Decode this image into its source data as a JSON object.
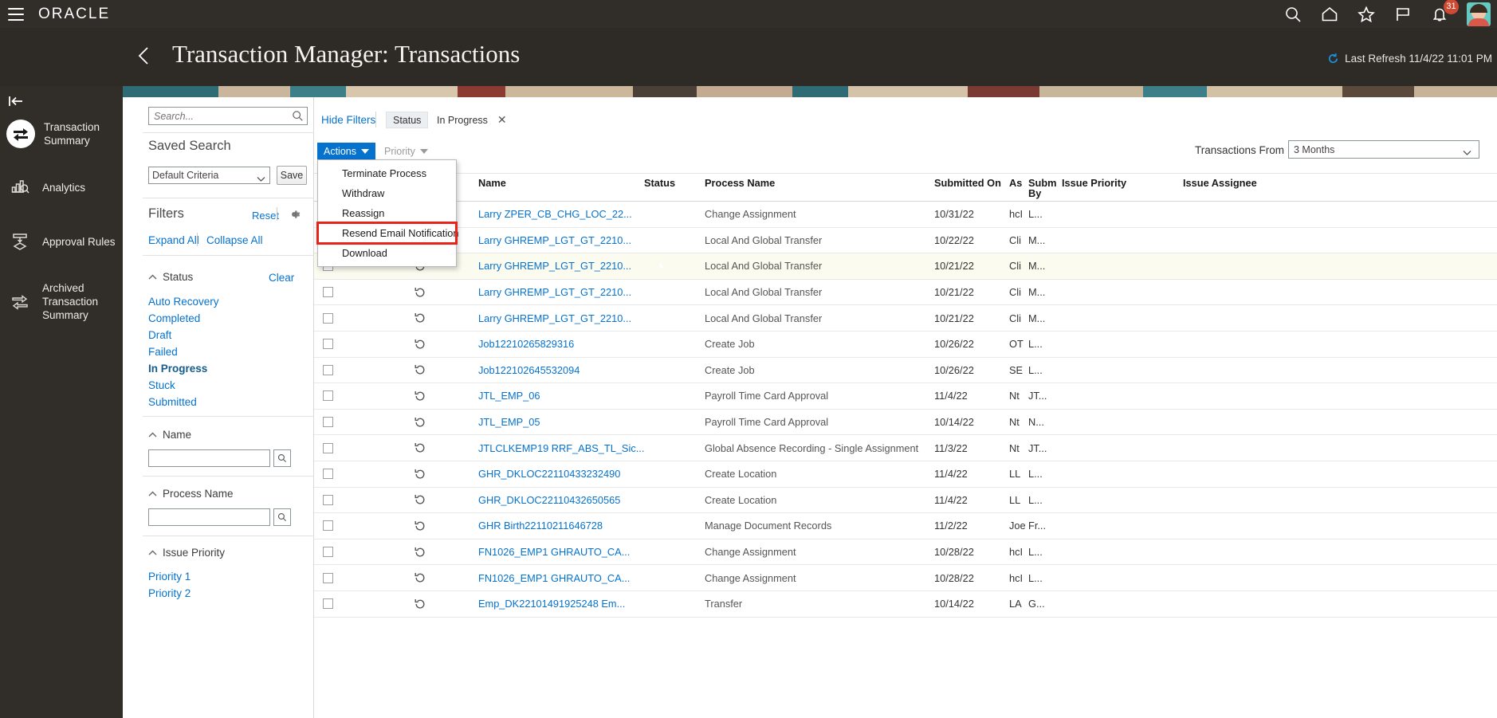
{
  "header": {
    "logo": "ORACLE",
    "menu_icon": "hamburger-icon",
    "icons": [
      "search-icon",
      "home-icon",
      "favorites-star-icon",
      "flag-icon",
      "notifications-bell-icon"
    ],
    "notification_count": "31"
  },
  "page": {
    "title": "Transaction Manager: Transactions",
    "last_refresh": "Last Refresh 11/4/22 11:01 PM",
    "back_label": "back-chevron"
  },
  "sidebar": {
    "collapse_label": "collapse-rail",
    "items": [
      {
        "label": "Transaction Summary",
        "icon": "transfer-arrows-icon",
        "active": true
      },
      {
        "label": "Analytics",
        "icon": "analytics-bars-icon",
        "active": false
      },
      {
        "label": "Approval Rules",
        "icon": "approval-flow-icon",
        "active": false
      },
      {
        "label": "Archived Transaction Summary",
        "icon": "archive-transfer-icon",
        "active": false
      }
    ]
  },
  "filters_panel": {
    "search_placeholder": "Search...",
    "saved_search_label": "Saved Search",
    "saved_search_value": "Default Criteria",
    "save_button": "Save",
    "filters_label": "Filters",
    "reset_link": "Reset",
    "gear_icon": "gear-icon",
    "expand_all": "Expand All",
    "collapse_all": "Collapse All",
    "groups": [
      {
        "name": "Status",
        "clear": "Clear",
        "options": [
          {
            "label": "Auto Recovery",
            "selected": false
          },
          {
            "label": "Completed",
            "selected": false
          },
          {
            "label": "Draft",
            "selected": false
          },
          {
            "label": "Failed",
            "selected": false
          },
          {
            "label": "In Progress",
            "selected": true
          },
          {
            "label": "Stuck",
            "selected": false
          },
          {
            "label": "Submitted",
            "selected": false
          }
        ]
      },
      {
        "name": "Name",
        "input_value": ""
      },
      {
        "name": "Process Name",
        "input_value": ""
      },
      {
        "name": "Issue Priority",
        "options": [
          {
            "label": "Priority 1",
            "selected": false
          },
          {
            "label": "Priority 2",
            "selected": false
          }
        ]
      }
    ]
  },
  "toolbar": {
    "hide_filters": "Hide Filters",
    "chip_key": "Status",
    "chip_value": "In Progress",
    "chip_remove": "✕",
    "actions_button": "Actions",
    "priority_button": "Priority",
    "transactions_from_label": "Transactions From",
    "transactions_from_value": "3 Months"
  },
  "actions_menu": {
    "open": true,
    "items": [
      {
        "label": "Terminate Process",
        "highlighted": false
      },
      {
        "label": "Withdraw",
        "highlighted": false
      },
      {
        "label": "Reassign",
        "highlighted": false
      },
      {
        "label": "Resend Email Notification",
        "highlighted": true
      },
      {
        "label": "Download",
        "highlighted": false
      }
    ],
    "highlight_color": "#e8241a"
  },
  "table": {
    "columns": [
      "Name",
      "Status",
      "Process Name",
      "Submitted On",
      "As",
      "Subm By",
      "Issue Priority",
      "Issue Assignee"
    ],
    "rows": [
      {
        "name": "Larry ZPER_CB_CHG_LOC_22...",
        "status": "in-progress-clock",
        "process": "Change Assignment",
        "submitted": "10/31/22",
        "as": "hcI",
        "by": "L..."
      },
      {
        "name": "Larry GHREMP_LGT_GT_2210...",
        "status": "in-progress-clock",
        "process": "Local And Global Transfer",
        "submitted": "10/22/22",
        "as": "Cli",
        "by": "M..."
      },
      {
        "name": "Larry GHREMP_LGT_GT_2210...",
        "status": "in-progress-clock",
        "process": "Local And Global Transfer",
        "submitted": "10/21/22",
        "as": "Cli",
        "by": "M..."
      },
      {
        "name": "Larry GHREMP_LGT_GT_2210...",
        "status": "in-progress-clock",
        "process": "Local And Global Transfer",
        "submitted": "10/21/22",
        "as": "Cli",
        "by": "M..."
      },
      {
        "name": "Larry GHREMP_LGT_GT_2210...",
        "status": "in-progress-clock",
        "process": "Local And Global Transfer",
        "submitted": "10/21/22",
        "as": "Cli",
        "by": "M..."
      },
      {
        "name": "Job12210265829316",
        "status": "in-progress-clock",
        "process": "Create Job",
        "submitted": "10/26/22",
        "as": "OT",
        "by": "L..."
      },
      {
        "name": "Job122102645532094",
        "status": "in-progress-clock",
        "process": "Create Job",
        "submitted": "10/26/22",
        "as": "SE",
        "by": "L..."
      },
      {
        "name": "JTL_EMP_06",
        "status": "in-progress-clock",
        "process": "Payroll Time Card Approval",
        "submitted": "11/4/22",
        "as": "Nt",
        "by": "JT..."
      },
      {
        "name": "JTL_EMP_05",
        "status": "in-progress-clock",
        "process": "Payroll Time Card Approval",
        "submitted": "10/14/22",
        "as": "Nt",
        "by": "N..."
      },
      {
        "name": "JTLCLKEMP19 RRF_ABS_TL_Sic...",
        "status": "in-progress-clock",
        "process": "Global Absence Recording - Single Assignment",
        "submitted": "11/3/22",
        "as": "Nt",
        "by": "JT..."
      },
      {
        "name": "GHR_DKLOC22110433232490",
        "status": "in-progress-clock",
        "process": "Create Location",
        "submitted": "11/4/22",
        "as": "LL",
        "by": "L..."
      },
      {
        "name": "GHR_DKLOC22110432650565",
        "status": "in-progress-clock",
        "process": "Create Location",
        "submitted": "11/4/22",
        "as": "LL",
        "by": "L..."
      },
      {
        "name": "GHR Birth22110211646728",
        "status": "in-progress-clock",
        "process": "Manage Document Records",
        "submitted": "11/2/22",
        "as": "Joe",
        "by": "Fr..."
      },
      {
        "name": "FN1026_EMP1 GHRAUTO_CA...",
        "status": "in-progress-clock",
        "process": "Change Assignment",
        "submitted": "10/28/22",
        "as": "hcI",
        "by": "L..."
      },
      {
        "name": "FN1026_EMP1 GHRAUTO_CA...",
        "status": "in-progress-clock",
        "process": "Change Assignment",
        "submitted": "10/28/22",
        "as": "hcI",
        "by": "L..."
      },
      {
        "name": "Emp_DK22101491925248 Em...",
        "status": "in-progress-clock",
        "process": "Transfer",
        "submitted": "10/14/22",
        "as": "LA",
        "by": "G..."
      }
    ]
  }
}
